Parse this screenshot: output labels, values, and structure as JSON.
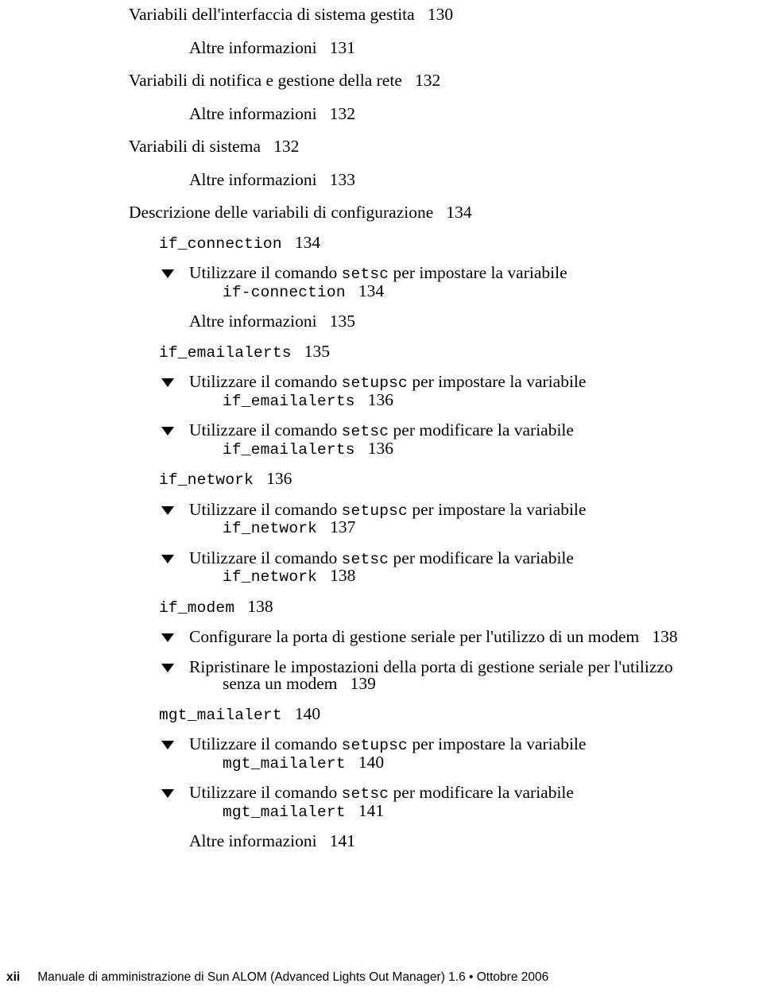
{
  "page": {
    "type": "table-of-contents",
    "folio": "xii",
    "footer_text": "Manuale di amministrazione di Sun ALOM (Advanced Lights Out Manager) 1.6 • Ottobre 2006",
    "background_color": "#ffffff",
    "text_color": "#000000"
  },
  "toc": {
    "entries": [
      {
        "id": "e1",
        "kind": "heading",
        "level": 1,
        "text": "Variabili dell'interfaccia di sistema gestita",
        "page": "130"
      },
      {
        "id": "e2",
        "kind": "heading",
        "level": 2,
        "text": "Altre informazioni",
        "page": "131"
      },
      {
        "id": "e3",
        "kind": "heading",
        "level": 1,
        "text": "Variabili di notifica e gestione della rete",
        "page": "132"
      },
      {
        "id": "e4",
        "kind": "heading",
        "level": 2,
        "text": "Altre informazioni",
        "page": "132"
      },
      {
        "id": "e5",
        "kind": "heading",
        "level": 1,
        "text": "Variabili di sistema",
        "page": "132"
      },
      {
        "id": "e6",
        "kind": "heading",
        "level": 2,
        "text": "Altre informazioni",
        "page": "133"
      },
      {
        "id": "e7",
        "kind": "heading",
        "level": 1,
        "text": "Descrizione delle variabili di configurazione",
        "page": "134"
      },
      {
        "id": "e8",
        "kind": "mono",
        "level": 2,
        "text": "if_connection",
        "page": "134"
      },
      {
        "id": "e9",
        "kind": "procedure",
        "lead": "Utilizzare il comando ",
        "cmd": "setsc",
        "tail": " per impostare la variabile",
        "cont_mono": "if-connection",
        "page": "134"
      },
      {
        "id": "e10",
        "kind": "heading",
        "level": 2,
        "text": "Altre informazioni",
        "page": "135"
      },
      {
        "id": "e11",
        "kind": "mono",
        "level": 2,
        "text": "if_emailalerts",
        "page": "135"
      },
      {
        "id": "e12",
        "kind": "procedure",
        "lead": "Utilizzare il comando ",
        "cmd": "setupsc",
        "tail": " per impostare la variabile",
        "cont_mono": "if_emailalerts",
        "page": "136"
      },
      {
        "id": "e13",
        "kind": "procedure",
        "lead": "Utilizzare il comando ",
        "cmd": "setsc",
        "tail": " per modificare la variabile",
        "cont_mono": "if_emailalerts",
        "page": "136"
      },
      {
        "id": "e14",
        "kind": "mono",
        "level": 2,
        "text": "if_network",
        "page": "136"
      },
      {
        "id": "e15",
        "kind": "procedure",
        "lead": "Utilizzare il comando ",
        "cmd": "setupsc",
        "tail": " per impostare la variabile",
        "cont_mono": "if_network",
        "page": "137"
      },
      {
        "id": "e16",
        "kind": "procedure",
        "lead": "Utilizzare il comando ",
        "cmd": "setsc",
        "tail": " per modificare la variabile",
        "cont_mono": "if_network",
        "page": "138"
      },
      {
        "id": "e17",
        "kind": "mono",
        "level": 2,
        "text": "if_modem",
        "page": "138"
      },
      {
        "id": "e18",
        "kind": "procedure_plain",
        "text": "Configurare la porta di gestione seriale per l'utilizzo di un modem",
        "page": "138"
      },
      {
        "id": "e19",
        "kind": "procedure_wrap",
        "text": "Ripristinare le impostazioni della porta di gestione seriale per l'utilizzo",
        "cont_text": "senza un modem",
        "page": "139"
      },
      {
        "id": "e20",
        "kind": "mono",
        "level": 2,
        "text": "mgt_mailalert",
        "page": "140"
      },
      {
        "id": "e21",
        "kind": "procedure",
        "lead": "Utilizzare il comando ",
        "cmd": "setupsc",
        "tail": " per impostare la variabile",
        "cont_mono": "mgt_mailalert",
        "page": "140"
      },
      {
        "id": "e22",
        "kind": "procedure",
        "lead": "Utilizzare il comando ",
        "cmd": "setsc",
        "tail": " per modificare la variabile",
        "cont_mono": "mgt_mailalert",
        "page": "141"
      },
      {
        "id": "e23",
        "kind": "heading",
        "level": 2,
        "text": "Altre informazioni",
        "page": "141"
      }
    ]
  }
}
